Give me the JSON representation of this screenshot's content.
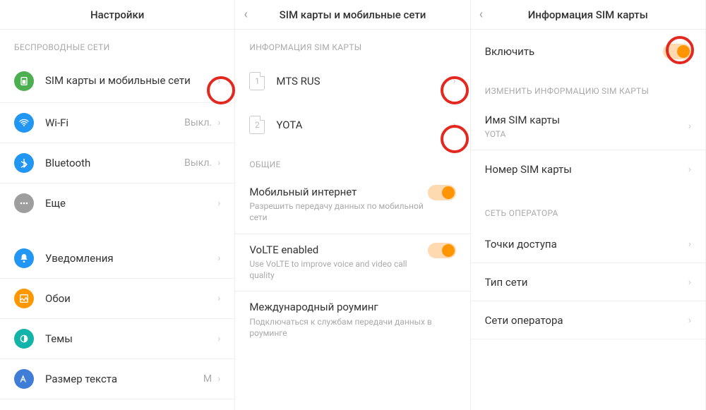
{
  "panels": {
    "settings": {
      "title": "Настройки",
      "section_wireless": "БЕСПРОВОДНЫЕ СЕТИ",
      "items": {
        "sim": {
          "label": "SIM карты и мобильные сети"
        },
        "wifi": {
          "label": "Wi-Fi",
          "value": "Выкл."
        },
        "bluetooth": {
          "label": "Bluetooth",
          "value": "Выкл."
        },
        "more": {
          "label": "Еще"
        },
        "notifications": {
          "label": "Уведомления"
        },
        "wallpaper": {
          "label": "Обои"
        },
        "themes": {
          "label": "Темы"
        },
        "textsize": {
          "label": "Размер текста",
          "value": "М"
        }
      }
    },
    "sim": {
      "title": "SIM карты и мобильные сети",
      "section_info": "ИНФОРМАЦИЯ SIM КАРТЫ",
      "sim1": {
        "num": "1",
        "label": "MTS RUS"
      },
      "sim2": {
        "num": "2",
        "label": "YOTA"
      },
      "section_general": "ОБЩИЕ",
      "mobiledata": {
        "label": "Мобильный интернет",
        "sub": "Разрешить передачу данных по мобильной сети"
      },
      "volte": {
        "label": "VoLTE enabled",
        "sub": "Use VoLTE to improve voice and video call quality"
      },
      "roaming": {
        "label": "Международный роуминг",
        "sub": "Подключаться к службам передачи данных в роуминге"
      }
    },
    "siminfo": {
      "title": "Информация SIM карты",
      "enable": "Включить",
      "section_edit": "ИЗМЕНИТЬ ИНФОРМАЦИЮ SIM КАРТЫ",
      "simname": {
        "label": "Имя SIM карты",
        "sub": "YOTA"
      },
      "simnumber": {
        "label": "Номер SIM карты"
      },
      "section_operator": "СЕТЬ ОПЕРАТОРА",
      "apn": {
        "label": "Точки доступа"
      },
      "nettype": {
        "label": "Тип сети"
      },
      "opnets": {
        "label": "Сети оператора"
      }
    }
  }
}
